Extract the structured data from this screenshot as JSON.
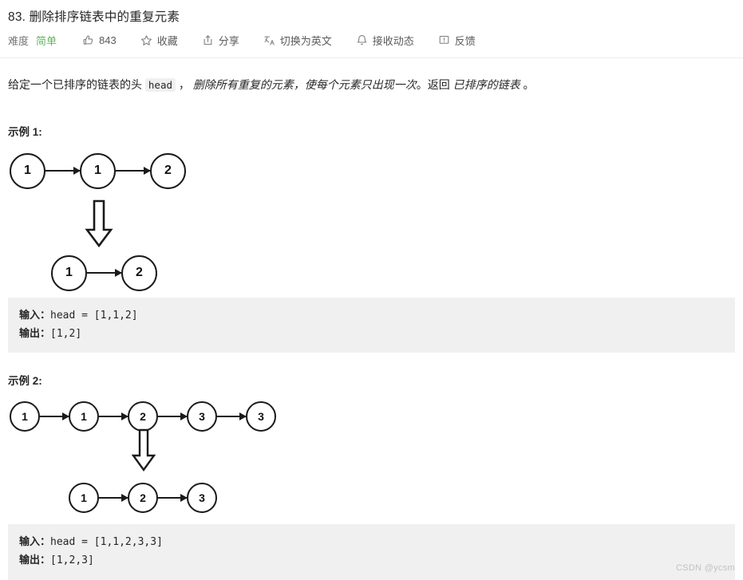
{
  "header": {
    "title": "83. 删除排序链表中的重复元素",
    "toolbar": {
      "difficulty_label": "难度",
      "difficulty_value": "简单",
      "likes_count": "843",
      "favorite_label": "收藏",
      "share_label": "分享",
      "translate_label": "切换为英文",
      "subscribe_label": "接收动态",
      "feedback_label": "反馈",
      "icons": {
        "thumbs_up": "thumbs-up-icon",
        "star": "star-icon",
        "share": "share-icon",
        "translate": "translate-icon",
        "bell": "bell-icon",
        "feedback": "feedback-icon"
      },
      "colors": {
        "easy_green": "#5cb85c",
        "text_gray": "#5b5b5b"
      }
    }
  },
  "description": {
    "part1": "给定一个已排序的链表的头 ",
    "code": "head",
    "part2": " ， ",
    "italic1": "删除所有重复的元素，使每个元素只出现一次",
    "part3": "。返回 ",
    "italic2": "已排序的链表",
    "part4": " 。"
  },
  "examples": [
    {
      "title": "示例 1:",
      "input_nodes": [
        "1",
        "1",
        "2"
      ],
      "output_nodes": [
        "1",
        "2"
      ],
      "input_label": "输入：",
      "input_value": "head = [1,1,2]",
      "output_label": "输出：",
      "output_value": "[1,2]"
    },
    {
      "title": "示例 2:",
      "input_nodes": [
        "1",
        "1",
        "2",
        "3",
        "3"
      ],
      "output_nodes": [
        "1",
        "2",
        "3"
      ],
      "input_label": "输入：",
      "input_value": "head = [1,1,2,3,3]",
      "output_label": "输出：",
      "output_value": "[1,2,3]"
    }
  ],
  "watermark": "CSDN @ycsm"
}
